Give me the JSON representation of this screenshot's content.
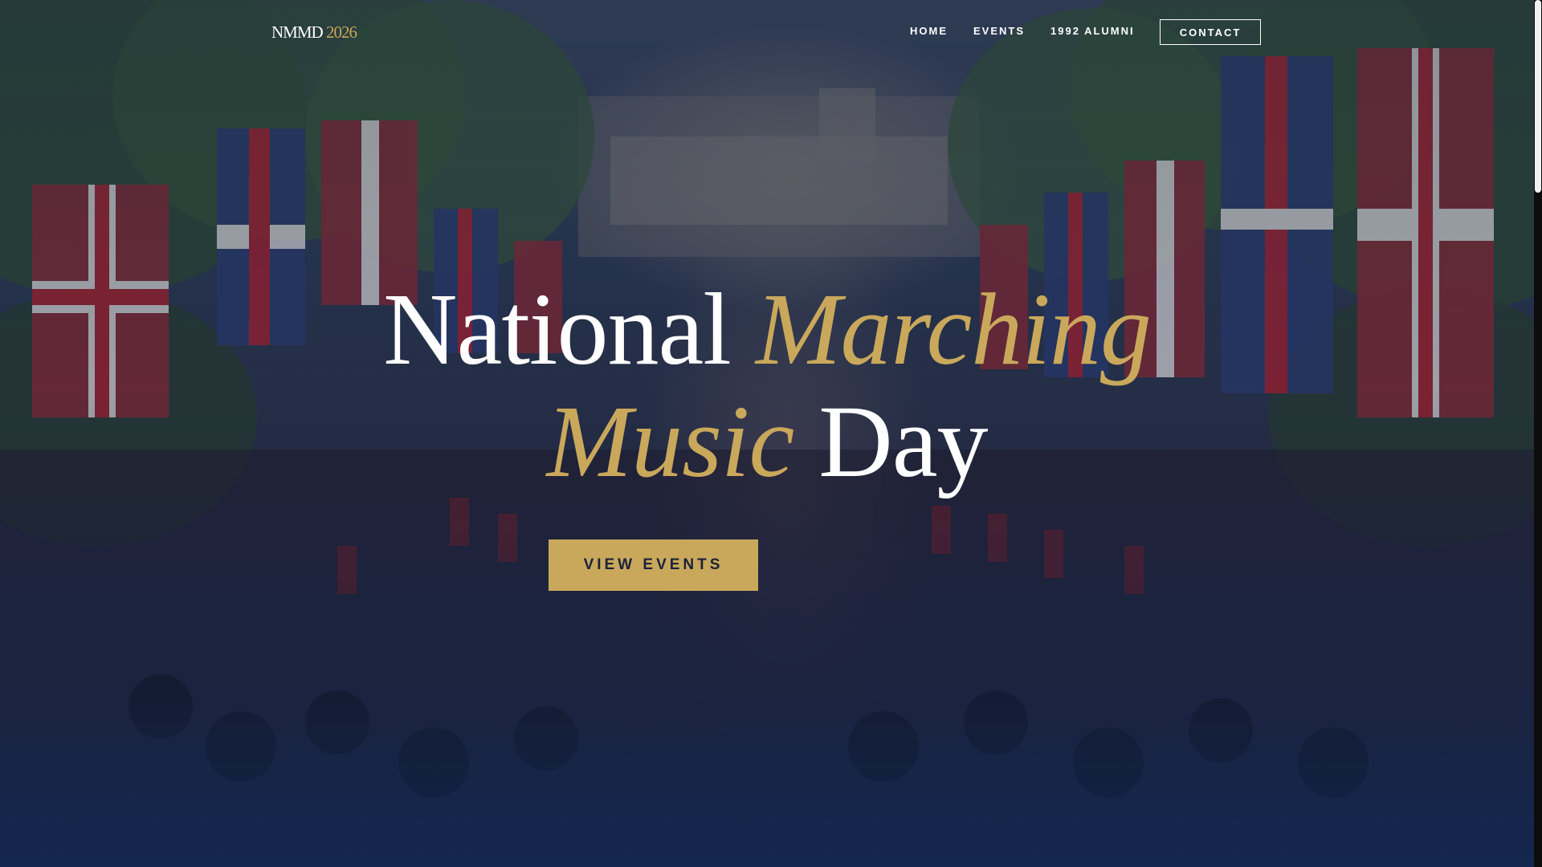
{
  "header": {
    "logo_main": "NMMD",
    "logo_year": "2026",
    "nav": [
      {
        "label": "HOME"
      },
      {
        "label": "EVENTS"
      },
      {
        "label": "1992 ALUMNI"
      }
    ],
    "contact_label": "CONTACT"
  },
  "hero": {
    "title_word1": "National",
    "title_word2": "Marching",
    "title_word3": "Music",
    "title_word4": "Day",
    "cta_label": "VIEW EVENTS"
  },
  "colors": {
    "accent_gold": "#c9a85c",
    "overlay_navy": "#192a4d",
    "text_white": "#ffffff"
  }
}
